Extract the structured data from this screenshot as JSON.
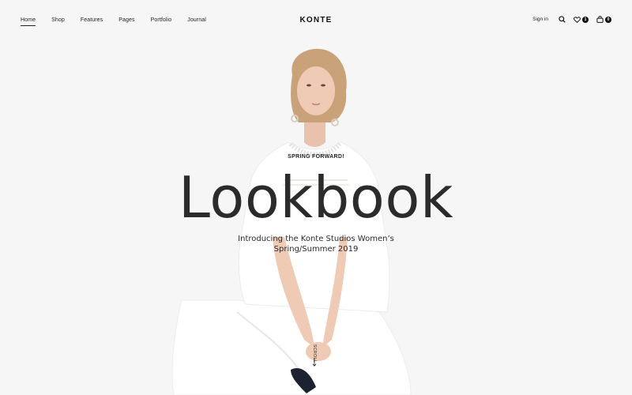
{
  "nav": {
    "items": [
      {
        "label": "Home",
        "active": true
      },
      {
        "label": "Shop"
      },
      {
        "label": "Features"
      },
      {
        "label": "Pages"
      },
      {
        "label": "Portfolio"
      },
      {
        "label": "Journal"
      }
    ],
    "logo": "KONTE",
    "signin": "Sign in",
    "wishlist_count": "1",
    "cart_count": "0"
  },
  "hero": {
    "eyebrow": "SPRING FORWARD!",
    "title": "Lookbook",
    "subtitle_line1": "Introducing the Konte Studios Women’s",
    "subtitle_line2": "Spring/Summer 2019",
    "scroll_label": "SCROLL"
  },
  "colors": {
    "background": "#f6f6f6",
    "text": "#222222",
    "garment": "#ffffff"
  }
}
